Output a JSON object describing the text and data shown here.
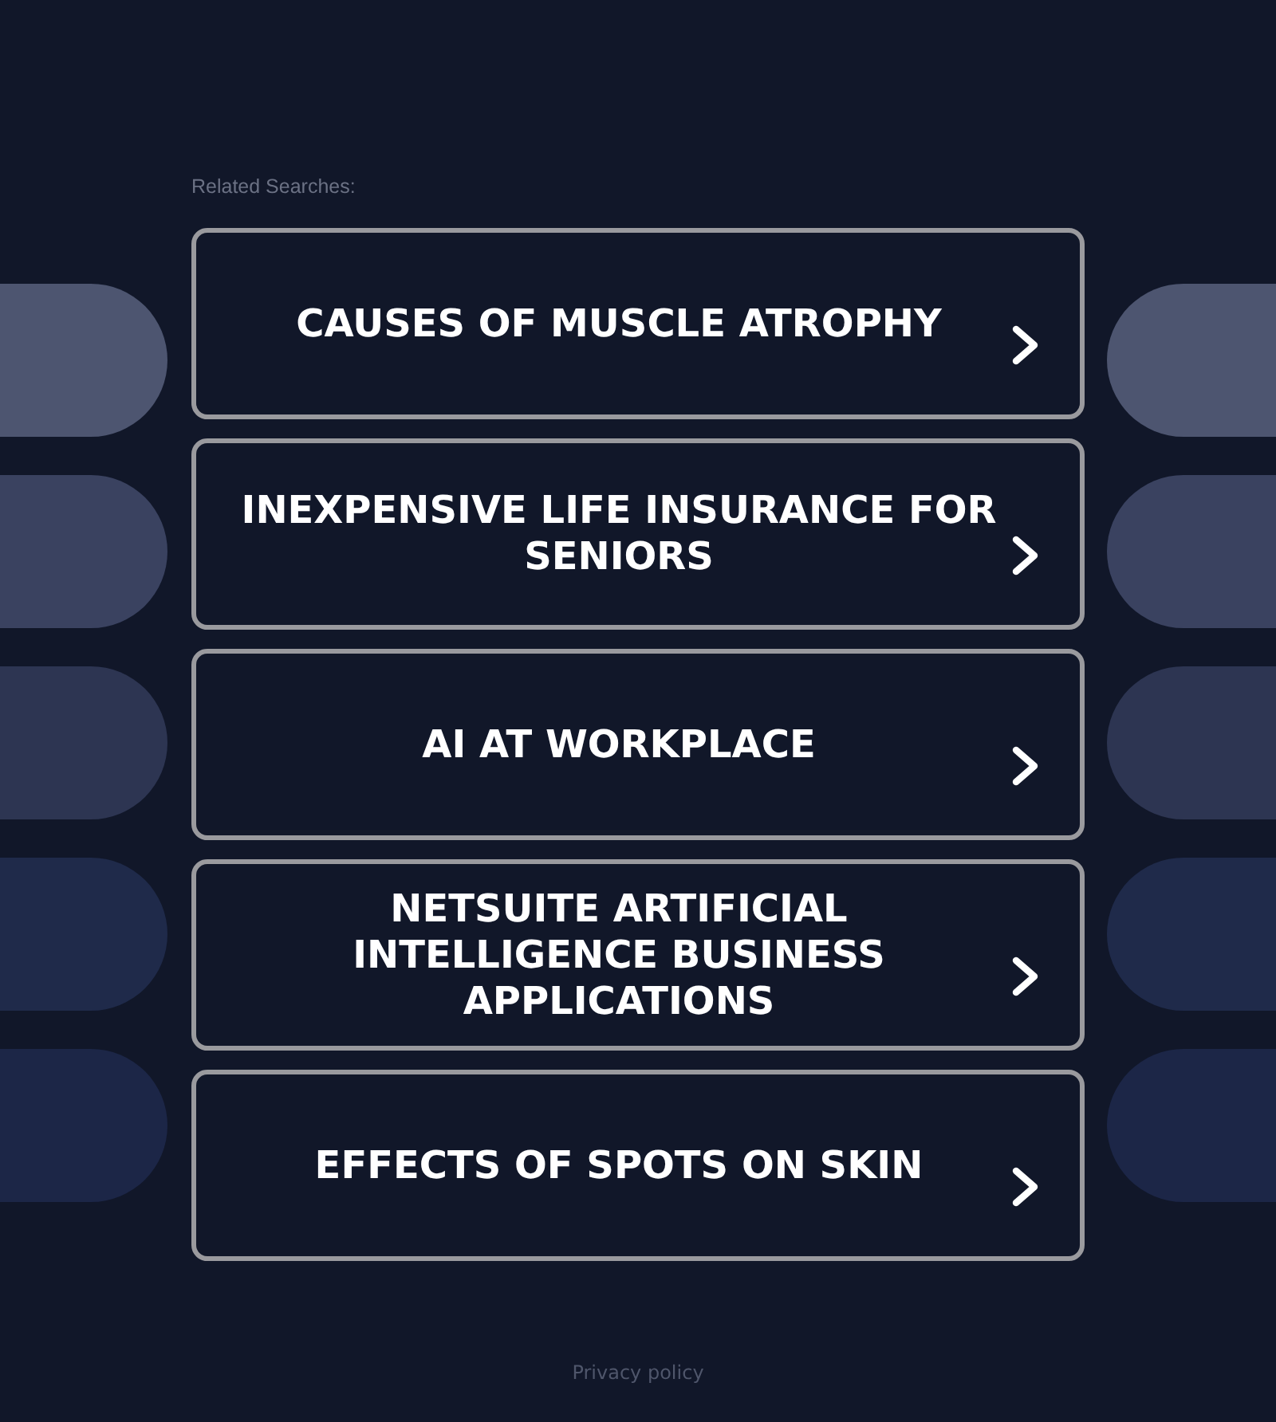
{
  "related_label": "Related Searches:",
  "links": [
    {
      "label": "CAUSES OF MUSCLE ATROPHY"
    },
    {
      "label": "INEXPENSIVE LIFE INSURANCE FOR SENIORS"
    },
    {
      "label": "AI AT WORKPLACE"
    },
    {
      "label": "NETSUITE ARTIFICIAL INTELLIGENCE BUSINESS APPLICATIONS"
    },
    {
      "label": "EFFECTS OF SPOTS ON SKIN"
    }
  ],
  "footer": {
    "privacy_link": "Privacy policy"
  }
}
